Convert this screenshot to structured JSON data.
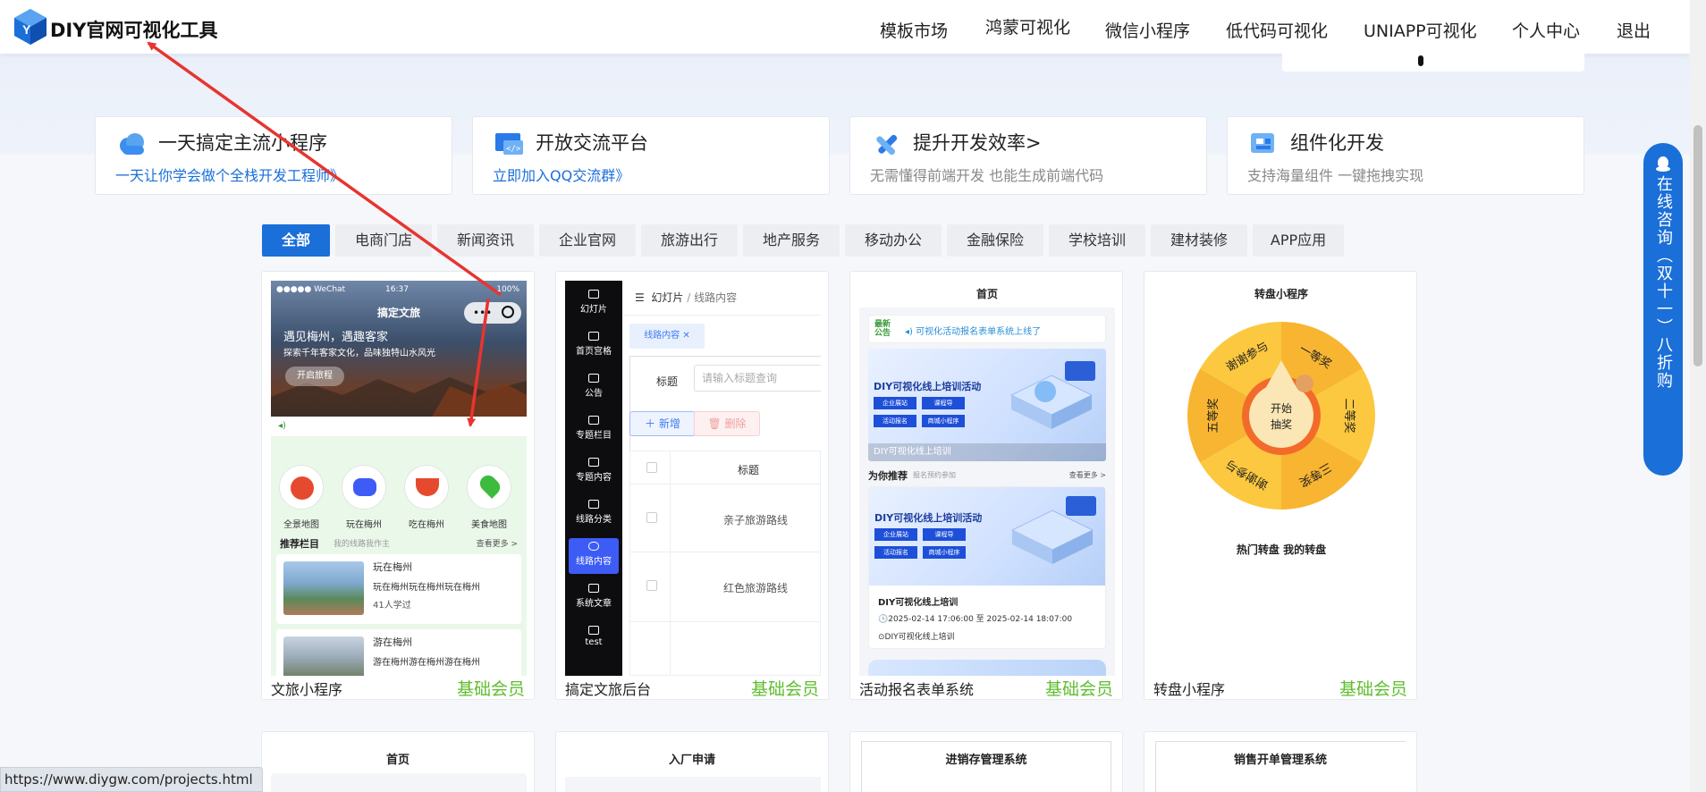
{
  "header": {
    "logo_text": "DIY官网可视化工具",
    "nav": [
      "模板市场",
      "鸿蒙可视化",
      "微信小程序",
      "低代码可视化",
      "UNIAPP可视化",
      "个人中心",
      "退出"
    ]
  },
  "features": [
    {
      "title": "一天搞定主流小程序",
      "subtitle": "一天让你学会做个全栈开发工程师》",
      "icon": "cloud-icon"
    },
    {
      "title": "开放交流平台",
      "subtitle": "立即加入QQ交流群》",
      "icon": "code-screen-icon"
    },
    {
      "title": "提升开发效率>",
      "subtitle": "无需懂得前端开发 也能生成前端代码",
      "icon": "tools-icon"
    },
    {
      "title": "组件化开发",
      "subtitle": "支持海量组件 一键拖拽实现",
      "icon": "components-icon"
    }
  ],
  "tabs": [
    "全部",
    "电商门店",
    "新闻资讯",
    "企业官网",
    "旅游出行",
    "地产服务",
    "移动办公",
    "金融保险",
    "学校培训",
    "建材装修",
    "APP应用"
  ],
  "cards": [
    {
      "name": "文旅小程序",
      "tag": "基础会员"
    },
    {
      "name": "搞定文旅后台",
      "tag": "基础会员"
    },
    {
      "name": "活动报名表单系统",
      "tag": "基础会员"
    },
    {
      "name": "转盘小程序",
      "tag": "基础会员"
    }
  ],
  "card1_preview": {
    "status_carrier": "●●●●● WeChat",
    "status_time": "16:37",
    "status_battery": "100%",
    "title": "搞定文旅",
    "hero_line1": "遇见梅州，遇趣客家",
    "hero_line2": "探索千年客家文化，品味独特山水风光",
    "hero_button": "开启旅程",
    "categories": [
      "全景地图",
      "玩在梅州",
      "吃在梅州",
      "美食地图"
    ],
    "rec_title": "推荐栏目",
    "rec_sub": "我的线路我作主",
    "rec_more": "查看更多 >",
    "items": [
      {
        "title": "玩在梅州",
        "desc": "玩在梅州玩在梅州玩在梅州",
        "meta": "41人学过"
      },
      {
        "title": "游在梅州",
        "desc": "游在梅州游在梅州游在梅州",
        "meta": ""
      }
    ]
  },
  "card2_preview": {
    "sidebar": [
      "幻灯片",
      "首页宫格",
      "公告",
      "专题栏目",
      "专题内容",
      "线路分类",
      "线路内容",
      "系统文章",
      "test"
    ],
    "breadcrumb_root": "幻灯片",
    "breadcrumb_sep": "/",
    "breadcrumb_current": "线路内容",
    "tab": "线路内容 ✕",
    "filter_label": "标题",
    "filter_placeholder": "请输入标题查询",
    "add_button": "＋ 新增",
    "delete_button": "删除",
    "table_header": "标题",
    "rows": [
      "亲子旅游路线",
      "红色旅游路线"
    ]
  },
  "card3_preview": {
    "title": "首页",
    "notice_badge": "最新公告",
    "notice_text": "可视化活动报名表单系统上线了",
    "banner_title": "DIY可视化线上培训活动",
    "banner_buttons": [
      "企业展站",
      "课程导",
      "活动报名",
      "商城小程序"
    ],
    "banner_caption": "DIY可视化线上培训",
    "rec_title": "为你推荐",
    "rec_sub": "报名预约参加",
    "rec_more": "查看更多 >",
    "event_title": "DIY可视化线上培训",
    "event_time": "2025-02-14 17:06:00 至 2025-02-14 18:07:00",
    "event_location": "DIY可视化线上培训"
  },
  "card4_preview": {
    "title": "转盘小程序",
    "center": "开始\n抽奖",
    "prizes": [
      "一等奖",
      "二等奖",
      "三等奖",
      "谢谢参与",
      "五等奖",
      "谢谢参与"
    ],
    "footer": "热门转盘  我的转盘"
  },
  "row2_cards": [
    "首页",
    "入厂申请",
    "进销存管理系统",
    "销售开单管理系统"
  ],
  "float_contact": "在线咨询（双十一）八折购",
  "status_url": "https://www.diygw.com/projects.html",
  "colors": {
    "primary": "#1a6fd8",
    "member_tag": "#5fbd2f",
    "annotation_arrow": "#e8342f"
  }
}
